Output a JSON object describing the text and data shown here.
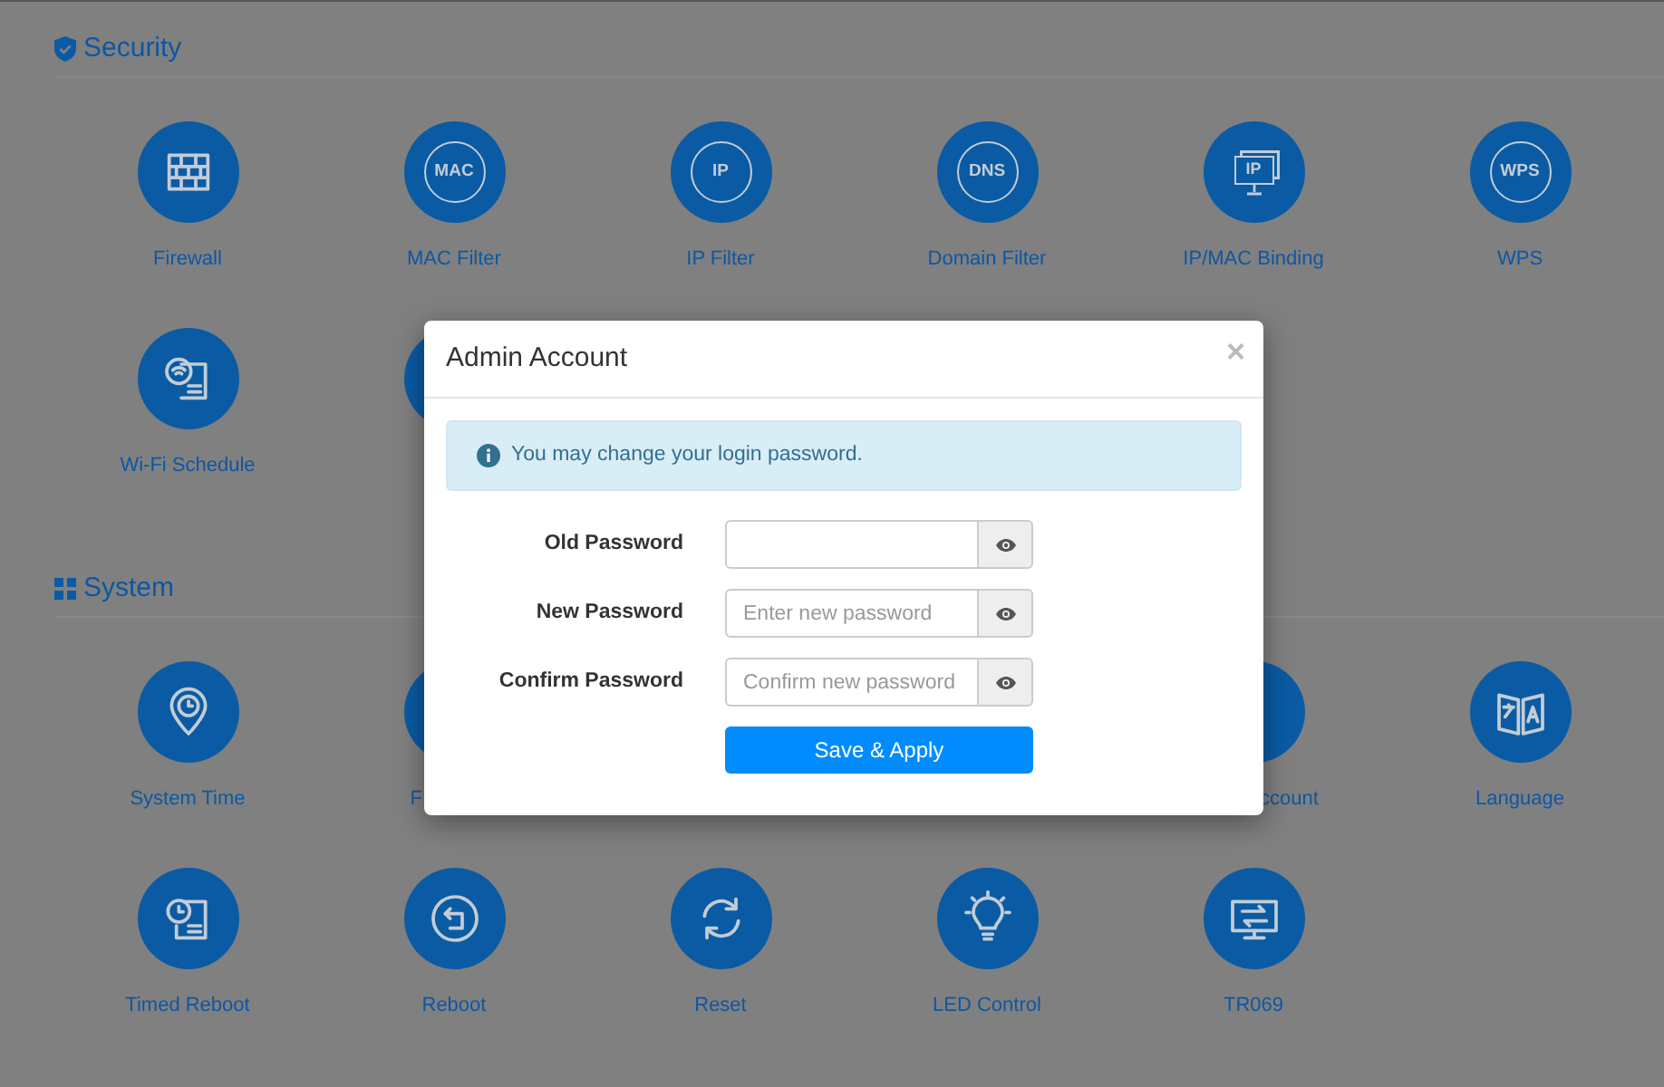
{
  "sections": [
    {
      "title": "Security",
      "rows": [
        [
          {
            "kind": "full",
            "label": "Firewall"
          },
          {
            "kind": "full",
            "badge": "MAC",
            "label": "MAC Filter"
          },
          {
            "kind": "full",
            "badge": "IP",
            "label": "IP Filter"
          },
          {
            "kind": "full",
            "badge": "DNS",
            "label": "Domain Filter"
          },
          {
            "kind": "full",
            "badge": "IP",
            "label": "IP/MAC Binding"
          },
          {
            "kind": "full",
            "badge": "WPS",
            "label": "WPS"
          }
        ],
        [
          {
            "kind": "full",
            "label": "Wi-Fi Schedule"
          },
          {
            "kind": "cut_right"
          }
        ]
      ]
    },
    {
      "title": "System",
      "rows": [
        [
          {
            "kind": "full",
            "label": "System Time"
          },
          {
            "kind": "cut_right",
            "label": "F"
          },
          {
            "kind": "cut_left",
            "label": "ccount"
          },
          {
            "kind": "full",
            "label": "Language"
          }
        ],
        [
          {
            "kind": "full",
            "label": "Timed Reboot"
          },
          {
            "kind": "full",
            "label": "Reboot"
          },
          {
            "kind": "full",
            "label": "Reset"
          },
          {
            "kind": "full",
            "label": "LED Control"
          },
          {
            "kind": "full",
            "label": "TR069"
          }
        ]
      ]
    }
  ],
  "dialog": {
    "title": "Admin Account",
    "close": "×",
    "notice": "You may change your login password.",
    "fields": [
      {
        "label": "Old Password"
      },
      {
        "label": "New Password",
        "placeholder": "Enter new password"
      },
      {
        "label": "Confirm Password",
        "placeholder": "Confirm new password"
      }
    ],
    "button": "Save & Apply"
  }
}
